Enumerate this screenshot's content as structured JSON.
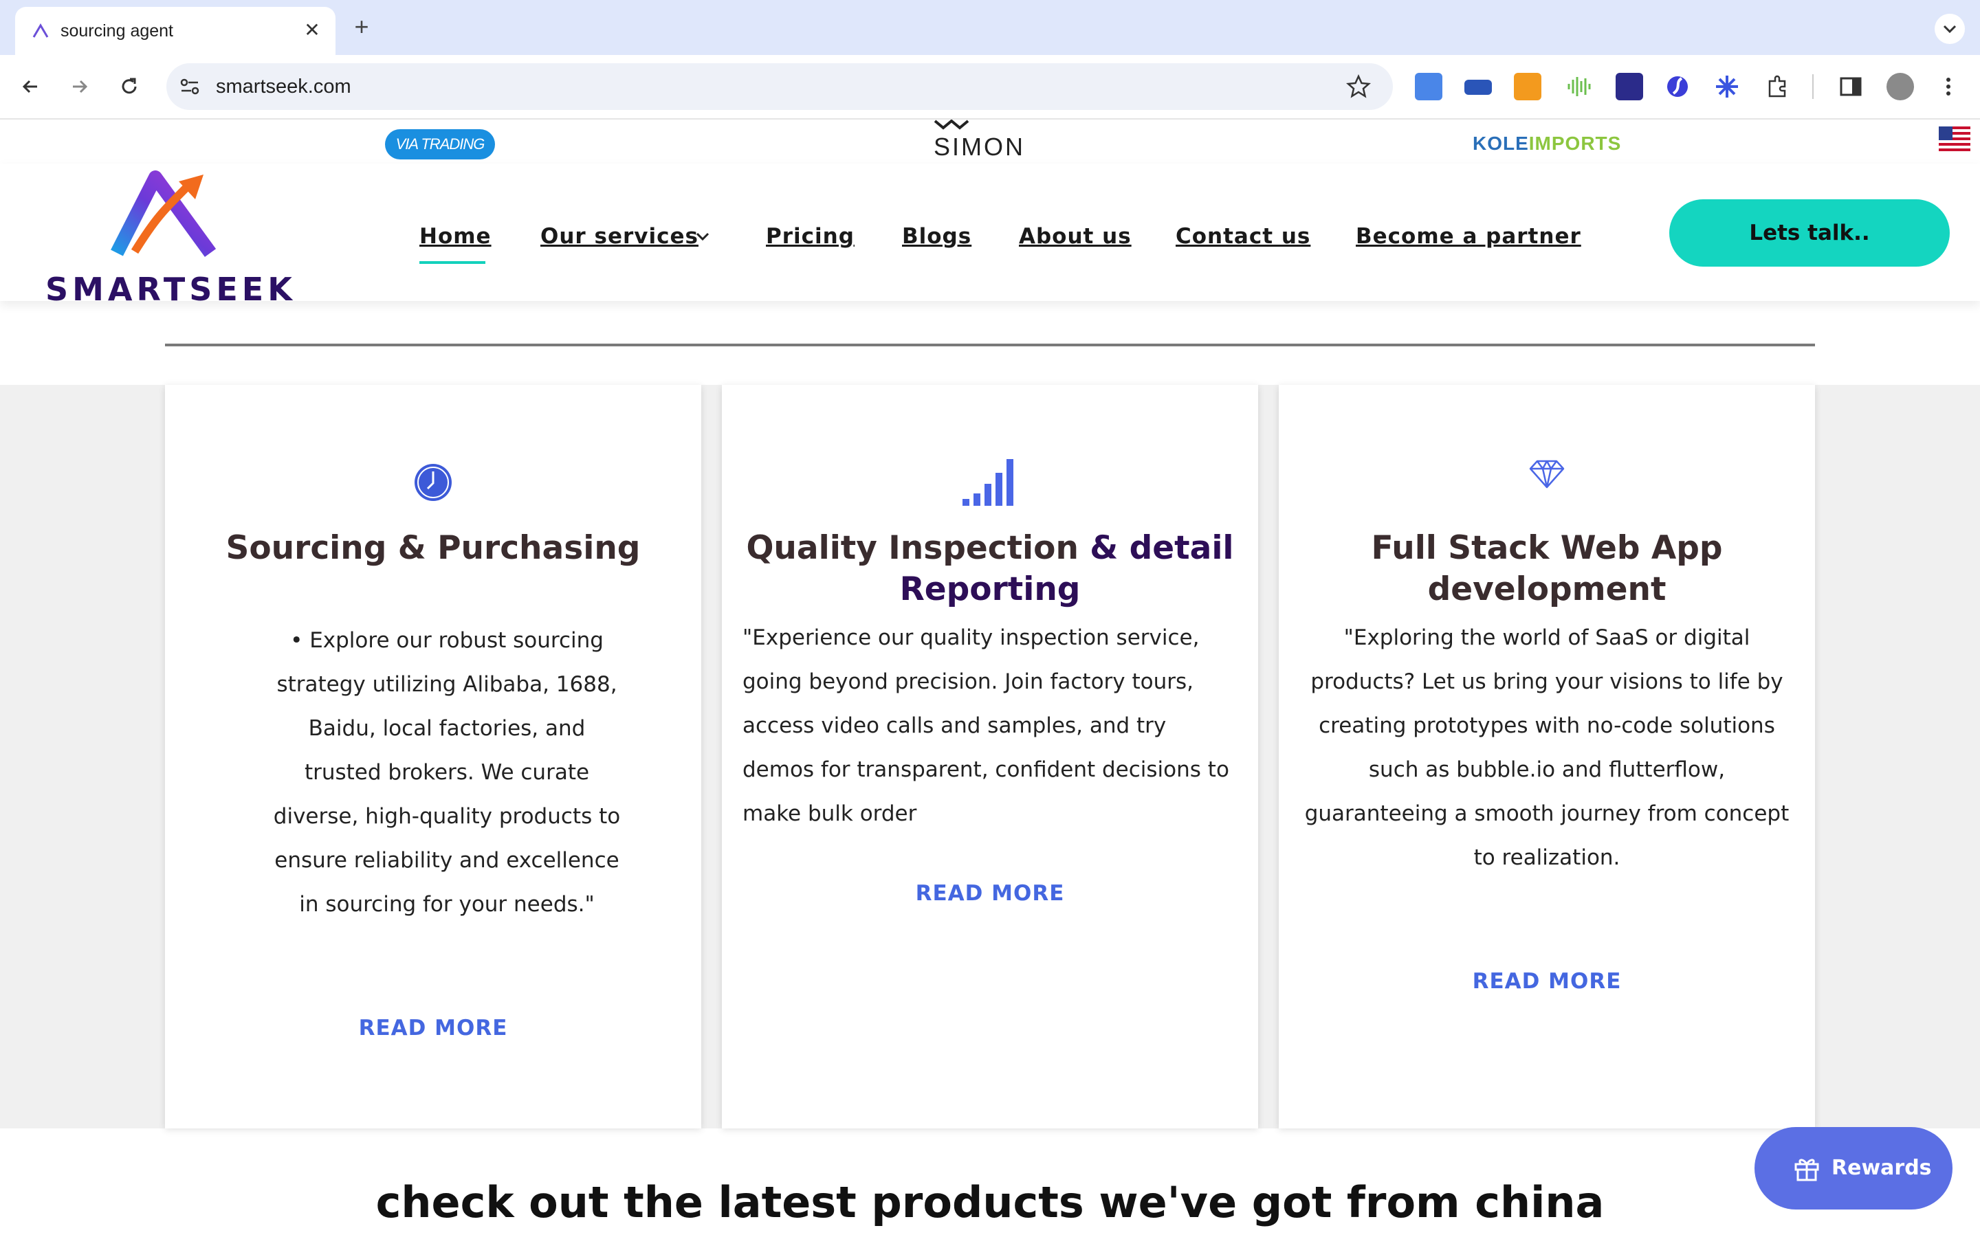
{
  "browser": {
    "tab_title": "sourcing agent",
    "url": "smartseek.com"
  },
  "partners": {
    "via": "VIA TRADING",
    "simon": "SIMON",
    "kole_a": "KOLE",
    "kole_b": "IMPORTS"
  },
  "header": {
    "logo_text": "SMARTSEEK",
    "nav": {
      "home": "Home",
      "services": "Our services",
      "pricing": "Pricing",
      "blogs": "Blogs",
      "about": "About us",
      "contact": "Contact us",
      "partner": "Become a partner"
    },
    "cta": "Lets talk.."
  },
  "services": {
    "card1": {
      "title": "Sourcing & Purchasing",
      "body": "• Explore our robust sourcing strategy utilizing Alibaba, 1688, Baidu, local factories, and trusted brokers. We curate diverse, high-quality products to ensure reliability and excellence in sourcing for your needs.\"",
      "readmore": "READ MORE",
      "icon": "clock-icon"
    },
    "card2": {
      "title_a": "Quality Inspection",
      "title_b": " & detail Reporting",
      "body": "\"Experience our quality inspection service, going beyond precision. Join factory tours, access video calls and samples, and try demos for transparent, confident decisions to make bulk order",
      "readmore": "READ MORE",
      "icon": "signal-bars-icon"
    },
    "card3": {
      "title": "Full Stack Web App development",
      "body": "\"Exploring the world of SaaS or digital products? Let us bring your visions to life by creating prototypes with no-code solutions such as bubble.io and flutterflow, guaranteeing a smooth journey from concept to realization.",
      "readmore": "READ MORE",
      "icon": "diamond-icon"
    }
  },
  "products_heading": "check out the latest products we've got from china",
  "rewards_label": "Rewards",
  "colors": {
    "accent_teal": "#14d5c0",
    "link_blue": "#4467e0",
    "brand_purple": "#2b1064"
  }
}
